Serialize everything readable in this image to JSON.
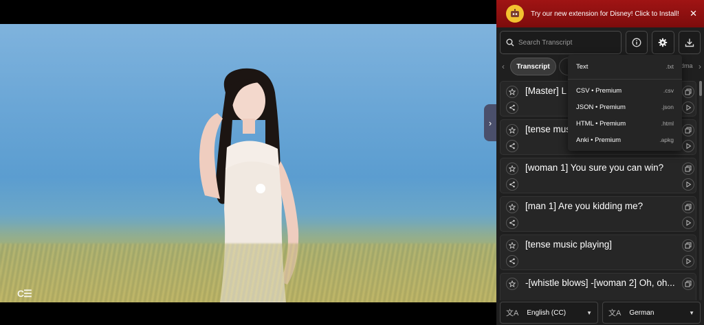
{
  "promo": {
    "text": "Try our new extension for Disney! Click to Install!",
    "close": "✕"
  },
  "search": {
    "placeholder": "Search Transcript"
  },
  "tabs": {
    "active_label": "Transcript",
    "overflow_text": "dma"
  },
  "transcript": [
    {
      "text": "[Master] L"
    },
    {
      "text": "[tense mus"
    },
    {
      "text": "[woman 1] You sure you can win?"
    },
    {
      "text": "[man 1] Are you kidding me?"
    },
    {
      "text": "[tense music playing]"
    },
    {
      "text": "-[whistle blows] -[woman 2] Oh, oh..."
    }
  ],
  "download_menu": [
    {
      "label": "Text",
      "ext": ".txt"
    },
    {
      "label": "CSV • Premium",
      "ext": ".csv"
    },
    {
      "label": "JSON • Premium",
      "ext": ".json"
    },
    {
      "label": "HTML • Premium",
      "ext": ".html"
    },
    {
      "label": "Anki • Premium",
      "ext": ".apkg"
    }
  ],
  "languages": {
    "primary": "English (CC)",
    "secondary": "German"
  },
  "colors": {
    "promo_bg": "#a01414",
    "panel_bg": "#1f1f1f"
  }
}
